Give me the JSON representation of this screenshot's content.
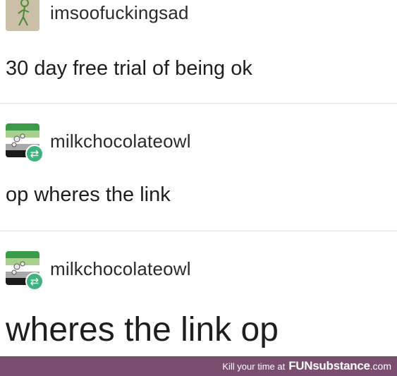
{
  "posts": [
    {
      "username": "imsoofuckingsad",
      "text": "30 day free trial of being ok",
      "avatar_icon": "stick-figure-avatar"
    },
    {
      "username": "milkchocolateowl",
      "text": "op wheres the link",
      "avatar_icon": "aromantic-flag-avatar",
      "badge_icon": "reblog-icon"
    },
    {
      "username": "milkchocolateowl",
      "text": "wheres the link op",
      "avatar_icon": "aromantic-flag-avatar",
      "badge_icon": "reblog-icon"
    }
  ],
  "footer": {
    "prefix": "Kill your time at",
    "brand": "FUNsubstance",
    "domain": ".com",
    "background": "#7a4e6f"
  },
  "colors": {
    "reblog_badge": "#3fb37f",
    "flag_green_dark": "#3a9c4b",
    "flag_green_light": "#a8d08d",
    "flag_grey": "#a9a9a9",
    "flag_black": "#1a1a1a"
  }
}
